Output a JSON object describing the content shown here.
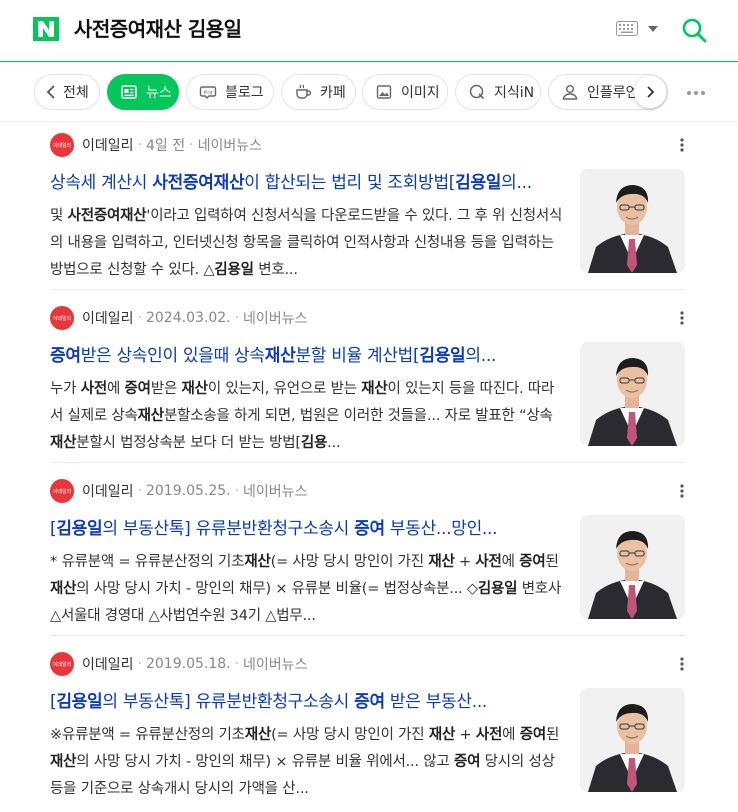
{
  "header": {
    "query": "사전증여재산 김용일",
    "colors": {
      "brand": "#03c75a",
      "link": "#0c3cb4"
    }
  },
  "tabs": {
    "back_label": "전체",
    "items": [
      {
        "label": "뉴스",
        "icon": "news-icon",
        "active": true
      },
      {
        "label": "블로그",
        "icon": "blog-icon"
      },
      {
        "label": "카페",
        "icon": "cafe-icon"
      },
      {
        "label": "이미지",
        "icon": "image-icon"
      },
      {
        "label": "지식iN",
        "icon": "kin-icon"
      },
      {
        "label": "인플루언서",
        "icon": "person-icon"
      }
    ]
  },
  "results": [
    {
      "press": "이데일리",
      "press_logo_text": "이데일리",
      "date": "4일 전",
      "source": "네이버뉴스",
      "title_html": "상속세 계산시 <b>사전증여재산</b>이 합산되는 법리 및 조회방법[<b>김용일</b>의...",
      "desc_html": "및 <b>사전증여재산</b>'이라고 입력하여 신청서식을 다운로드받을 수 있다. 그 후 위 신청서식의 내용을 입력하고, 인터넷신청 항목을 클릭하여 인적사항과 신청내용 등을 입력하는 방법으로 신청할 수 있다. △<b>김용일</b> 변호..."
    },
    {
      "press": "이데일리",
      "press_logo_text": "이데일리",
      "date": "2024.03.02.",
      "source": "네이버뉴스",
      "title_html": "<b>증여</b>받은 상속인이 있을때 상속<b>재산</b>분할 비율 계산법[<b>김용일</b>의...",
      "desc_html": "누가 <b>사전</b>에 <b>증여</b>받은 <b>재산</b>이 있는지, 유언으로 받는 <b>재산</b>이 있는지 등을 따진다. 따라서 실제로 상속<b>재산</b>분할소송을 하게 되면, 법원은 이러한 것들을... 자로 발표한 “상속<b>재산</b>분할시 법정상속분 보다 더 받는 방법[<b>김용</b>..."
    },
    {
      "press": "이데일리",
      "press_logo_text": "이데일리",
      "date": "2019.05.25.",
      "source": "네이버뉴스",
      "title_html": "[<b>김용일</b>의 부동산톡] 유류분반환청구소송시 <b>증여</b> 부동산...망인...",
      "desc_html": "* 유류분액 = 유류분산정의 기초<b>재산</b>(= 사망 당시 망인이 가진 <b>재산</b> + <b>사전</b>에 <b>증여</b>된 <b>재산</b>의 사망 당시 가치 - 망인의 채무) × 유류분 비율(= 법정상속분... ◇<b>김용일</b> 변호사 △서울대 경영대 △사법연수원 34기 △법무..."
    },
    {
      "press": "이데일리",
      "press_logo_text": "이데일리",
      "date": "2019.05.18.",
      "source": "네이버뉴스",
      "title_html": "[<b>김용일</b>의 부동산톡] 유류분반환청구소송시 <b>증여</b> 받은 부동산...",
      "desc_html": "※유류분액 = 유류분산정의 기초<b>재산</b>(= 사망 당시 망인이 가진 <b>재산</b> + <b>사전</b>에 <b>증여</b>된 <b>재산</b>의 사망 당시 가치 - 망인의 채무) × 유류분 비율 위에서... 않고 <b>증여</b> 당시의 성상 등을 기준으로 상속개시 당시의 가액을 산..."
    }
  ]
}
